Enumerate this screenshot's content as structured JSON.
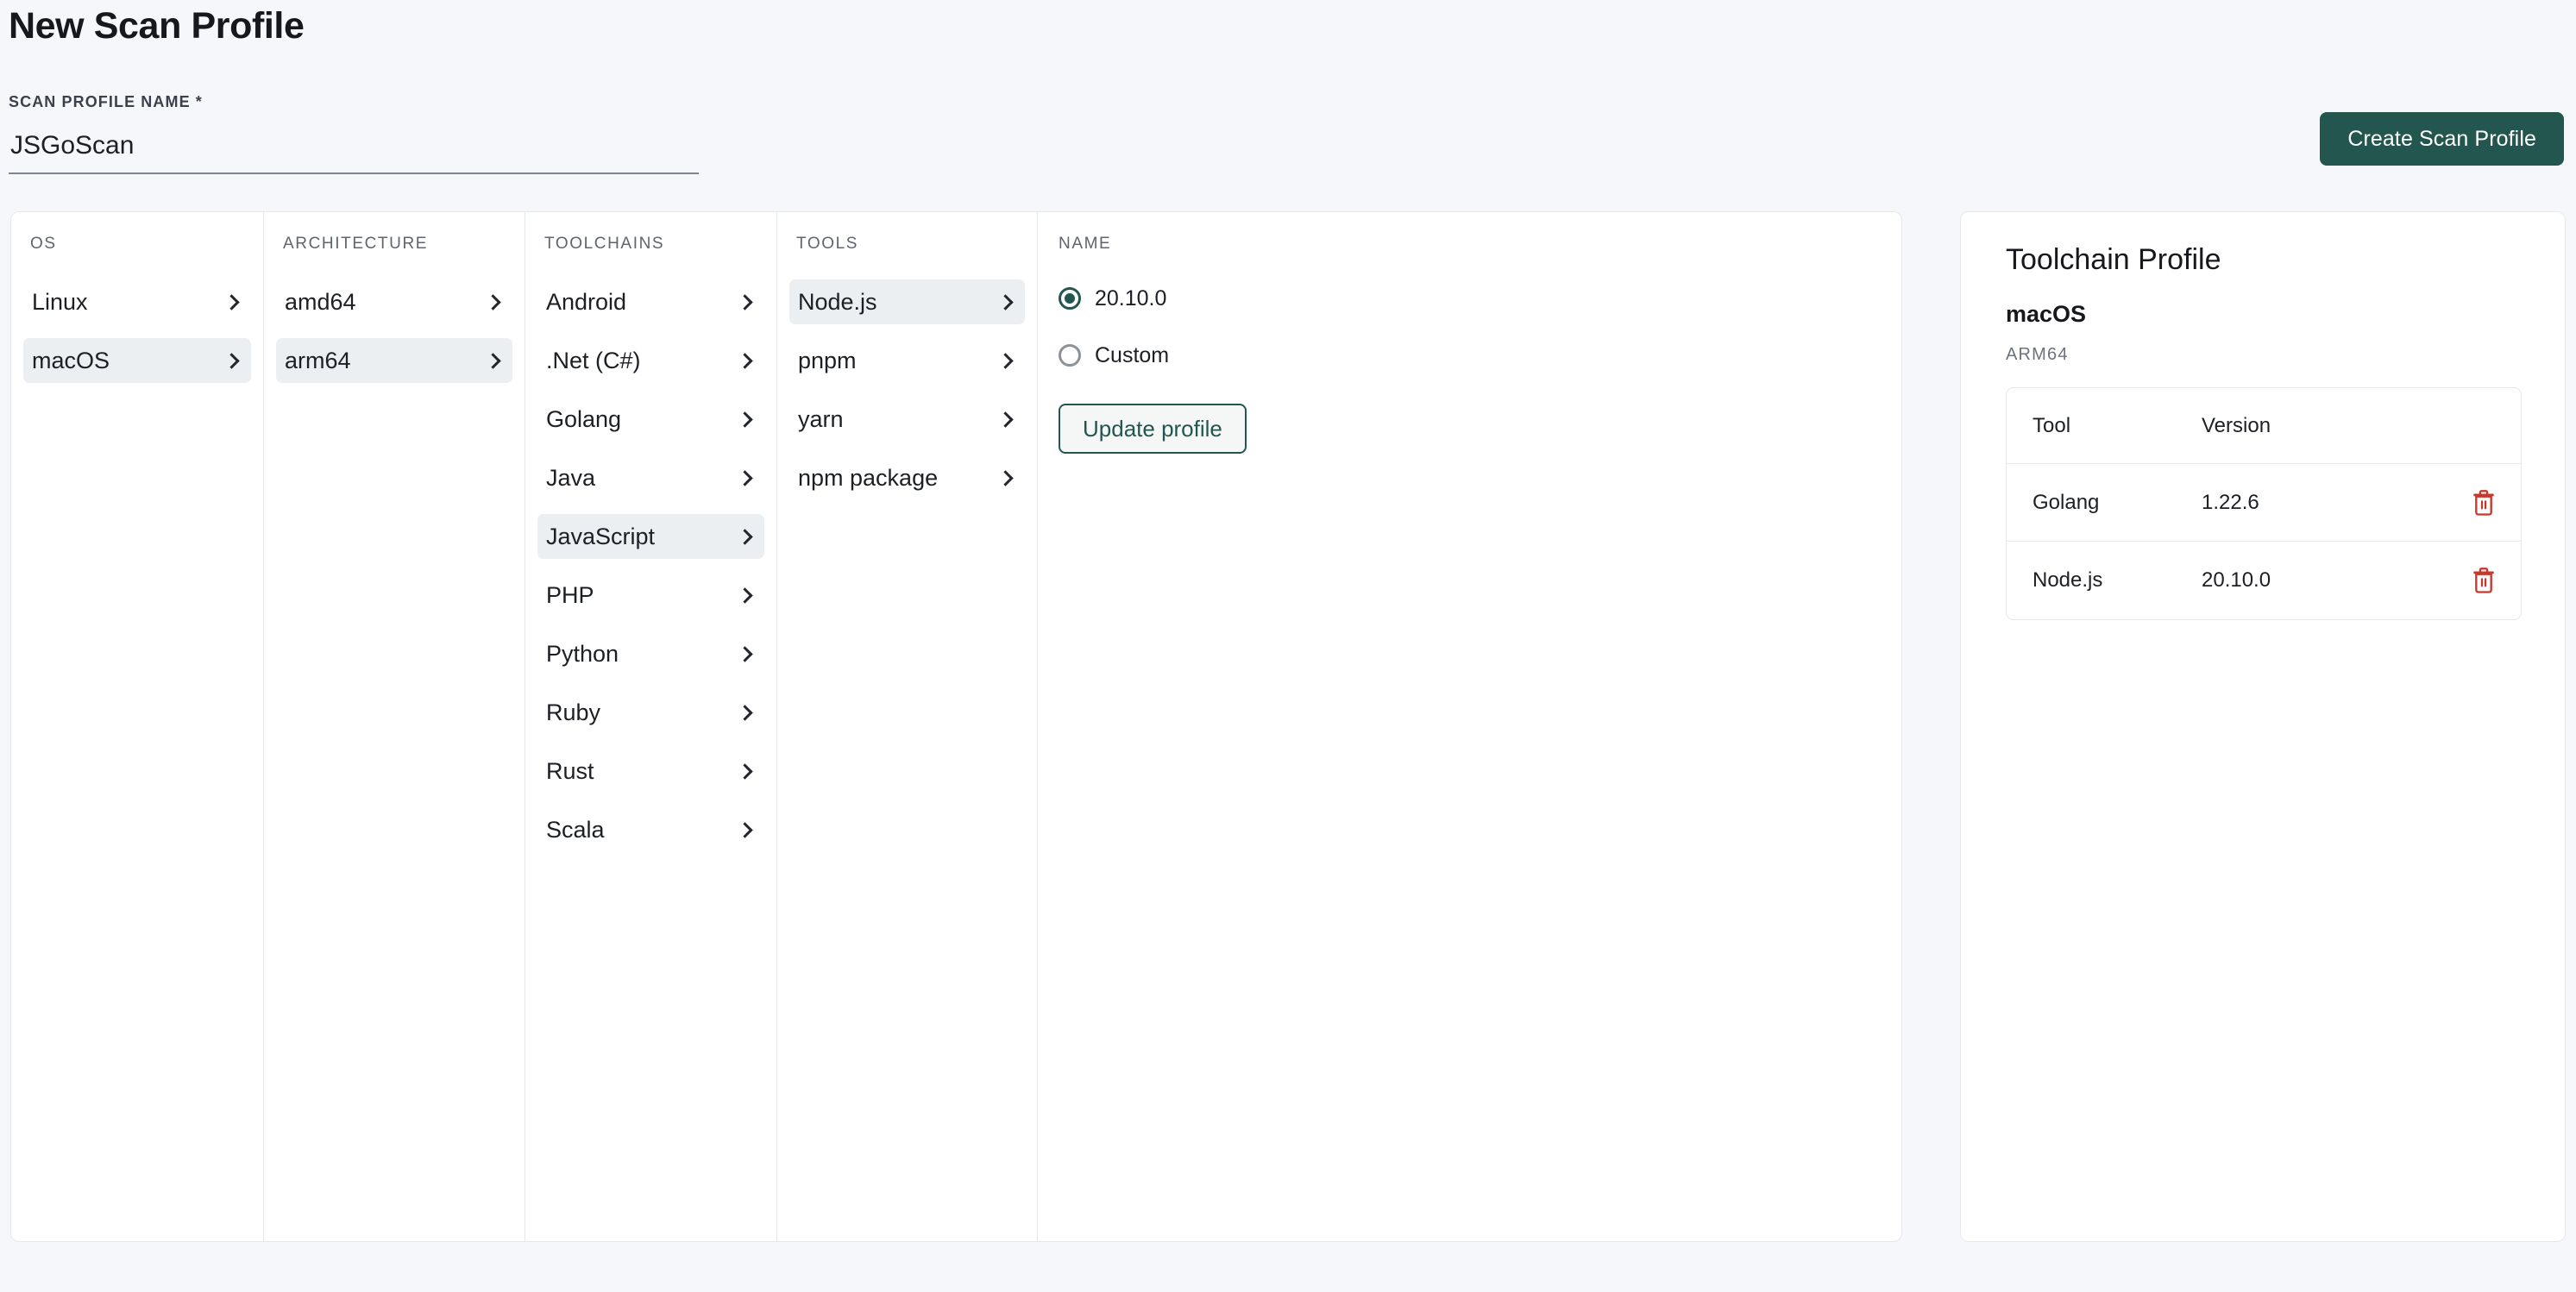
{
  "header": {
    "title": "New Scan Profile",
    "field_label": "SCAN PROFILE NAME *",
    "profile_name_value": "JSGoScan",
    "profile_name_placeholder": "",
    "create_button": "Create Scan Profile"
  },
  "columns": {
    "os": {
      "header": "OS",
      "items": [
        {
          "label": "Linux",
          "selected": false
        },
        {
          "label": "macOS",
          "selected": true
        }
      ]
    },
    "architecture": {
      "header": "ARCHITECTURE",
      "items": [
        {
          "label": "amd64",
          "selected": false
        },
        {
          "label": "arm64",
          "selected": true
        }
      ]
    },
    "toolchains": {
      "header": "TOOLCHAINS",
      "items": [
        {
          "label": "Android",
          "selected": false
        },
        {
          "label": ".Net (C#)",
          "selected": false
        },
        {
          "label": "Golang",
          "selected": false
        },
        {
          "label": "Java",
          "selected": false
        },
        {
          "label": "JavaScript",
          "selected": true
        },
        {
          "label": "PHP",
          "selected": false
        },
        {
          "label": "Python",
          "selected": false
        },
        {
          "label": "Ruby",
          "selected": false
        },
        {
          "label": "Rust",
          "selected": false
        },
        {
          "label": "Scala",
          "selected": false
        }
      ]
    },
    "tools": {
      "header": "TOOLS",
      "items": [
        {
          "label": "Node.js",
          "selected": true
        },
        {
          "label": "pnpm",
          "selected": false
        },
        {
          "label": "yarn",
          "selected": false
        },
        {
          "label": "npm package",
          "selected": false
        }
      ]
    },
    "name": {
      "header": "NAME",
      "options": [
        {
          "label": "20.10.0",
          "checked": true
        },
        {
          "label": "Custom",
          "checked": false
        }
      ],
      "update_button": "Update profile"
    }
  },
  "toolchain_profile": {
    "title": "Toolchain Profile",
    "os": "macOS",
    "architecture": "ARM64",
    "table": {
      "headers": {
        "tool": "Tool",
        "version": "Version"
      },
      "rows": [
        {
          "tool": "Golang",
          "version": "1.22.6",
          "delete_icon": "trash-icon"
        },
        {
          "tool": "Node.js",
          "version": "20.10.0",
          "delete_icon": "trash-icon"
        }
      ]
    }
  },
  "colors": {
    "accent": "#22564f",
    "page_background": "#f6f7fb",
    "selected_row": "#eceff1",
    "danger": "#c9372c"
  }
}
